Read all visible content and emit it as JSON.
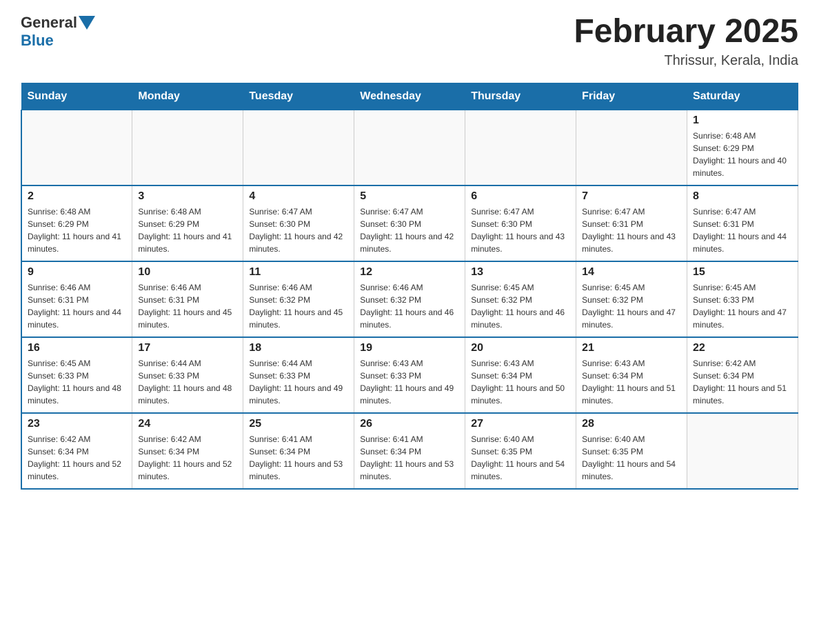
{
  "header": {
    "logo_general": "General",
    "logo_blue": "Blue",
    "month_title": "February 2025",
    "subtitle": "Thrissur, Kerala, India"
  },
  "days_of_week": [
    "Sunday",
    "Monday",
    "Tuesday",
    "Wednesday",
    "Thursday",
    "Friday",
    "Saturday"
  ],
  "weeks": [
    [
      {
        "date": "",
        "sunrise": "",
        "sunset": "",
        "daylight": ""
      },
      {
        "date": "",
        "sunrise": "",
        "sunset": "",
        "daylight": ""
      },
      {
        "date": "",
        "sunrise": "",
        "sunset": "",
        "daylight": ""
      },
      {
        "date": "",
        "sunrise": "",
        "sunset": "",
        "daylight": ""
      },
      {
        "date": "",
        "sunrise": "",
        "sunset": "",
        "daylight": ""
      },
      {
        "date": "",
        "sunrise": "",
        "sunset": "",
        "daylight": ""
      },
      {
        "date": "1",
        "sunrise": "Sunrise: 6:48 AM",
        "sunset": "Sunset: 6:29 PM",
        "daylight": "Daylight: 11 hours and 40 minutes."
      }
    ],
    [
      {
        "date": "2",
        "sunrise": "Sunrise: 6:48 AM",
        "sunset": "Sunset: 6:29 PM",
        "daylight": "Daylight: 11 hours and 41 minutes."
      },
      {
        "date": "3",
        "sunrise": "Sunrise: 6:48 AM",
        "sunset": "Sunset: 6:29 PM",
        "daylight": "Daylight: 11 hours and 41 minutes."
      },
      {
        "date": "4",
        "sunrise": "Sunrise: 6:47 AM",
        "sunset": "Sunset: 6:30 PM",
        "daylight": "Daylight: 11 hours and 42 minutes."
      },
      {
        "date": "5",
        "sunrise": "Sunrise: 6:47 AM",
        "sunset": "Sunset: 6:30 PM",
        "daylight": "Daylight: 11 hours and 42 minutes."
      },
      {
        "date": "6",
        "sunrise": "Sunrise: 6:47 AM",
        "sunset": "Sunset: 6:30 PM",
        "daylight": "Daylight: 11 hours and 43 minutes."
      },
      {
        "date": "7",
        "sunrise": "Sunrise: 6:47 AM",
        "sunset": "Sunset: 6:31 PM",
        "daylight": "Daylight: 11 hours and 43 minutes."
      },
      {
        "date": "8",
        "sunrise": "Sunrise: 6:47 AM",
        "sunset": "Sunset: 6:31 PM",
        "daylight": "Daylight: 11 hours and 44 minutes."
      }
    ],
    [
      {
        "date": "9",
        "sunrise": "Sunrise: 6:46 AM",
        "sunset": "Sunset: 6:31 PM",
        "daylight": "Daylight: 11 hours and 44 minutes."
      },
      {
        "date": "10",
        "sunrise": "Sunrise: 6:46 AM",
        "sunset": "Sunset: 6:31 PM",
        "daylight": "Daylight: 11 hours and 45 minutes."
      },
      {
        "date": "11",
        "sunrise": "Sunrise: 6:46 AM",
        "sunset": "Sunset: 6:32 PM",
        "daylight": "Daylight: 11 hours and 45 minutes."
      },
      {
        "date": "12",
        "sunrise": "Sunrise: 6:46 AM",
        "sunset": "Sunset: 6:32 PM",
        "daylight": "Daylight: 11 hours and 46 minutes."
      },
      {
        "date": "13",
        "sunrise": "Sunrise: 6:45 AM",
        "sunset": "Sunset: 6:32 PM",
        "daylight": "Daylight: 11 hours and 46 minutes."
      },
      {
        "date": "14",
        "sunrise": "Sunrise: 6:45 AM",
        "sunset": "Sunset: 6:32 PM",
        "daylight": "Daylight: 11 hours and 47 minutes."
      },
      {
        "date": "15",
        "sunrise": "Sunrise: 6:45 AM",
        "sunset": "Sunset: 6:33 PM",
        "daylight": "Daylight: 11 hours and 47 minutes."
      }
    ],
    [
      {
        "date": "16",
        "sunrise": "Sunrise: 6:45 AM",
        "sunset": "Sunset: 6:33 PM",
        "daylight": "Daylight: 11 hours and 48 minutes."
      },
      {
        "date": "17",
        "sunrise": "Sunrise: 6:44 AM",
        "sunset": "Sunset: 6:33 PM",
        "daylight": "Daylight: 11 hours and 48 minutes."
      },
      {
        "date": "18",
        "sunrise": "Sunrise: 6:44 AM",
        "sunset": "Sunset: 6:33 PM",
        "daylight": "Daylight: 11 hours and 49 minutes."
      },
      {
        "date": "19",
        "sunrise": "Sunrise: 6:43 AM",
        "sunset": "Sunset: 6:33 PM",
        "daylight": "Daylight: 11 hours and 49 minutes."
      },
      {
        "date": "20",
        "sunrise": "Sunrise: 6:43 AM",
        "sunset": "Sunset: 6:34 PM",
        "daylight": "Daylight: 11 hours and 50 minutes."
      },
      {
        "date": "21",
        "sunrise": "Sunrise: 6:43 AM",
        "sunset": "Sunset: 6:34 PM",
        "daylight": "Daylight: 11 hours and 51 minutes."
      },
      {
        "date": "22",
        "sunrise": "Sunrise: 6:42 AM",
        "sunset": "Sunset: 6:34 PM",
        "daylight": "Daylight: 11 hours and 51 minutes."
      }
    ],
    [
      {
        "date": "23",
        "sunrise": "Sunrise: 6:42 AM",
        "sunset": "Sunset: 6:34 PM",
        "daylight": "Daylight: 11 hours and 52 minutes."
      },
      {
        "date": "24",
        "sunrise": "Sunrise: 6:42 AM",
        "sunset": "Sunset: 6:34 PM",
        "daylight": "Daylight: 11 hours and 52 minutes."
      },
      {
        "date": "25",
        "sunrise": "Sunrise: 6:41 AM",
        "sunset": "Sunset: 6:34 PM",
        "daylight": "Daylight: 11 hours and 53 minutes."
      },
      {
        "date": "26",
        "sunrise": "Sunrise: 6:41 AM",
        "sunset": "Sunset: 6:34 PM",
        "daylight": "Daylight: 11 hours and 53 minutes."
      },
      {
        "date": "27",
        "sunrise": "Sunrise: 6:40 AM",
        "sunset": "Sunset: 6:35 PM",
        "daylight": "Daylight: 11 hours and 54 minutes."
      },
      {
        "date": "28",
        "sunrise": "Sunrise: 6:40 AM",
        "sunset": "Sunset: 6:35 PM",
        "daylight": "Daylight: 11 hours and 54 minutes."
      },
      {
        "date": "",
        "sunrise": "",
        "sunset": "",
        "daylight": ""
      }
    ]
  ]
}
